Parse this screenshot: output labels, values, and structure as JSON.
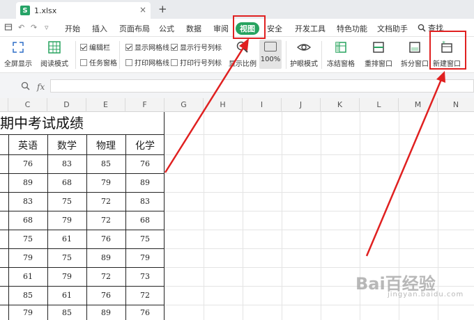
{
  "tab": {
    "filename": "1.xlsx",
    "icon": "S",
    "close": "×",
    "new": "+"
  },
  "menu": {
    "items": [
      "开始",
      "插入",
      "页面布局",
      "公式",
      "数据",
      "审阅",
      "视图",
      "安全",
      "开发工具",
      "特色功能",
      "文档助手"
    ],
    "active": "视图",
    "search": "查找"
  },
  "ribbon": {
    "fullscreen": "全屏显示",
    "read_mode": "阅读模式",
    "edit_bar": "编辑栏",
    "task_pane": "任务窗格",
    "show_gridlines": "显示网格线",
    "print_gridlines": "打印网格线",
    "show_headers": "显示行号列标",
    "print_headers": "打印行号列标",
    "zoom_ratio": "显示比例",
    "zoom_100": "100%",
    "eye_mode": "护眼模式",
    "freeze": "冻结窗格",
    "arrange": "重排窗口",
    "split": "拆分窗口",
    "new_window": "新建窗口"
  },
  "formula": {
    "fx": "fx"
  },
  "columns": [
    "C",
    "D",
    "E",
    "F",
    "G",
    "H",
    "I",
    "J",
    "K",
    "L",
    "M",
    "N"
  ],
  "sheet": {
    "title": "期中考试成绩",
    "headers": [
      "英语",
      "数学",
      "物理",
      "化学"
    ],
    "rows": [
      [
        "76",
        "83",
        "85",
        "76"
      ],
      [
        "89",
        "68",
        "79",
        "89"
      ],
      [
        "83",
        "75",
        "72",
        "83"
      ],
      [
        "68",
        "79",
        "72",
        "68"
      ],
      [
        "75",
        "61",
        "76",
        "75"
      ],
      [
        "79",
        "75",
        "89",
        "79"
      ],
      [
        "61",
        "79",
        "72",
        "73"
      ],
      [
        "85",
        "61",
        "76",
        "72"
      ],
      [
        "79",
        "85",
        "89",
        "76"
      ]
    ]
  },
  "watermark": {
    "text": "Bai百经验",
    "sub": "jingyan.baidu.com"
  },
  "colors": {
    "accent": "#27a35f",
    "highlight": "#e02020"
  }
}
